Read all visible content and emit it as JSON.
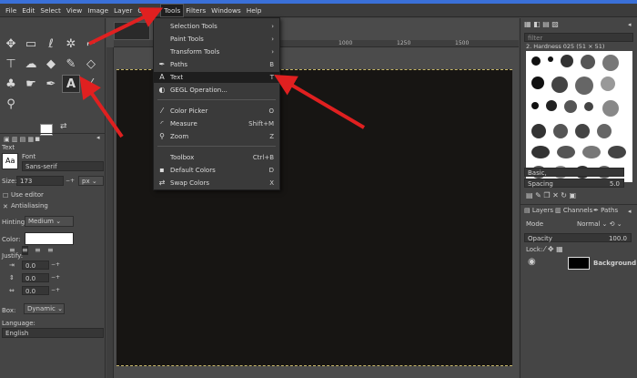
{
  "menubar": [
    "File",
    "Edit",
    "Select",
    "View",
    "Image",
    "Layer",
    "Colors",
    "Tools",
    "Filters",
    "Windows",
    "Help"
  ],
  "tools_menu": {
    "items": [
      {
        "label": "Selection Tools",
        "icon": "",
        "shortcut": "",
        "submenu": true
      },
      {
        "label": "Paint Tools",
        "icon": "",
        "shortcut": "",
        "submenu": true
      },
      {
        "label": "Transform Tools",
        "icon": "",
        "shortcut": "",
        "submenu": true
      },
      {
        "label": "Paths",
        "icon": "paths-icon",
        "shortcut": "B",
        "submenu": false
      },
      {
        "label": "Text",
        "icon": "text-icon",
        "shortcut": "T",
        "submenu": false
      },
      {
        "label": "GEGL Operation...",
        "icon": "gegl-icon",
        "shortcut": "",
        "submenu": false
      },
      {
        "label": "Color Picker",
        "icon": "color-picker-icon",
        "shortcut": "O",
        "submenu": false
      },
      {
        "label": "Measure",
        "icon": "measure-icon",
        "shortcut": "Shift+M",
        "submenu": false
      },
      {
        "label": "Zoom",
        "icon": "zoom-icon",
        "shortcut": "Z",
        "submenu": false
      },
      {
        "label": "Toolbox",
        "icon": "",
        "shortcut": "Ctrl+B",
        "submenu": false
      },
      {
        "label": "Default Colors",
        "icon": "default-colors-icon",
        "shortcut": "D",
        "submenu": false
      },
      {
        "label": "Swap Colors",
        "icon": "swap-colors-icon",
        "shortcut": "X",
        "submenu": false
      }
    ]
  },
  "tool_options": {
    "title": "Text",
    "font_label": "Font",
    "font_value": "Sans-serif",
    "size_label": "Size:",
    "size_value": "173",
    "size_unit": "px",
    "use_editor": "Use editor",
    "antialiasing": "Antialiasing",
    "hinting_label": "Hinting:",
    "hinting_value": "Medium",
    "color_label": "Color:",
    "justify_label": "Justify:",
    "indent_value": "0.0",
    "line_spacing_value": "0.0",
    "letter_spacing_value": "0.0",
    "box_label": "Box:",
    "box_value": "Dynamic",
    "language_label": "Language:",
    "language_value": "English",
    "aa_icon_text": "Aa"
  },
  "rulers": {
    "h": [
      "1000",
      "1250",
      "1500"
    ]
  },
  "brushes": {
    "filter_placeholder": "filter",
    "current_brush": "2. Hardness 025 (51 × 51)",
    "preset": "Basic,",
    "spacing_label": "Spacing",
    "spacing_value": "5.0"
  },
  "layers": {
    "tabs": [
      "Layers",
      "Channels",
      "Paths"
    ],
    "mode_label": "Mode",
    "mode_value": "Normal",
    "opacity_label": "Opacity",
    "opacity_value": "100.0",
    "lock_label": "Lock:",
    "layer_name": "Background"
  },
  "colors": {
    "accent": "#3a70d8",
    "arrow": "#e02020",
    "canvas": "#171513"
  }
}
